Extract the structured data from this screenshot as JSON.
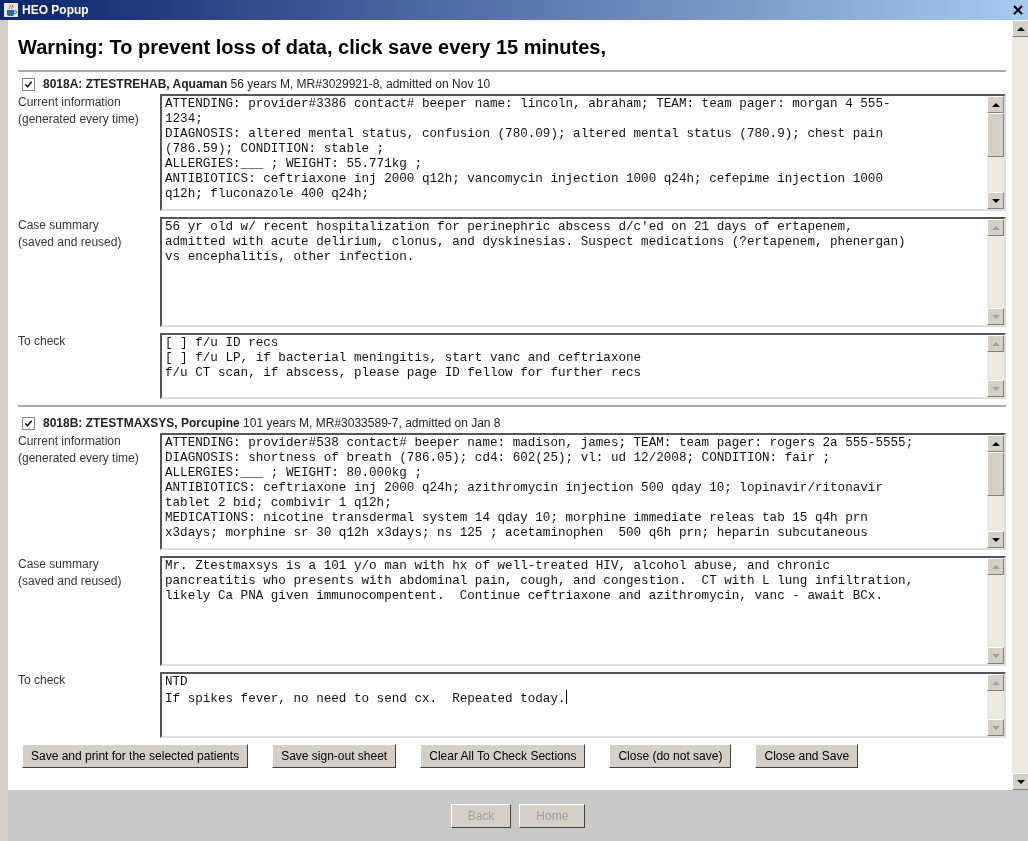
{
  "window": {
    "title": "HEO Popup"
  },
  "warning": "Warning: To prevent loss of data, click save every 15 minutes,",
  "patients": [
    {
      "checked": true,
      "header": "**8018A: ZTESTREHAB, Aquaman** 56 years M, MR#3029921-8, admitted on Nov 10",
      "fields": [
        {
          "kind": "current",
          "label": [
            "Current information",
            "(generated every time)"
          ],
          "focused": false,
          "lines": [
            "ATTENDING: provider#3386 contact# beeper name: lincoln, abraham; TEAM: team pager: morgan 4 555-",
            "1234;",
            "DIAGNOSIS: altered mental status, confusion (780.09); altered mental status (780.9); chest pain",
            "(786.59); CONDITION: stable ;",
            "ALLERGIES:___ ; WEIGHT: 55.771kg ;",
            "ANTIBIOTICS: ceftriaxone inj 2000 q12h; vancomycin injection 1000 q24h; cefepime injection 1000",
            "q12h; fluconazole 400 q24h;"
          ]
        },
        {
          "kind": "summary",
          "label": [
            "Case summary",
            "(saved and reused)"
          ],
          "focused": false,
          "lines": [
            "56 yr old w/ recent hospitalization for perinephric abscess d/c'ed on 21 days of ertapenem,",
            "admitted with acute delirium, clonus, and dyskinesias. Suspect medications (?ertapenem, phenergan)",
            "vs encephalitis, other infection."
          ]
        },
        {
          "kind": "check",
          "label": [
            "To check"
          ],
          "focused": false,
          "lines": [
            "[ ] f/u ID recs",
            "[ ] f/u LP, if bacterial meningitis, start vanc and ceftriaxone",
            "f/u CT scan, if abscess, please page ID fellow for further recs"
          ]
        }
      ]
    },
    {
      "checked": true,
      "header": "**8018B: ZTESTMAXSYS, Porcupine** 101 years M, MR#3033589-7, admitted on Jan 8",
      "fields": [
        {
          "kind": "current",
          "label": [
            "Current information",
            "(generated every time)"
          ],
          "focused": false,
          "lines": [
            "ATTENDING: provider#538 contact# beeper name: madison, james; TEAM: team pager: rogers 2a 555-5555;",
            "DIAGNOSIS: shortness of breath (786.05); cd4: 602(25); vl: ud 12/2008; CONDITION: fair ;",
            "ALLERGIES:___ ; WEIGHT: 80.000kg ;",
            "ANTIBIOTICS: ceftriaxone inj 2000 q24h; azithromycin injection 500 qday 10; lopinavir/ritonavir",
            "tablet 2 bid; combivir 1 q12h;",
            "MEDICATIONS: nicotine transdermal system 14 qday 10; morphine immediate releas tab 15 q4h prn",
            "x3days; morphine sr 30 q12h x3days; ns 125 ; acetaminophen  500 q6h prn; heparin subcutaneous"
          ]
        },
        {
          "kind": "summary",
          "label": [
            "Case summary",
            "(saved and reused)"
          ],
          "focused": false,
          "lines": [
            "Mr. Ztestmaxsys is a 101 y/o man with hx of well-treated HIV, alcohol abuse, and chronic",
            "pancreatitis who presents with abdominal pain, cough, and congestion.  CT with L lung infiltration,",
            "likely Ca PNA given immunocompentent.  Continue ceftriaxone and azithromycin, vanc - await BCx."
          ]
        },
        {
          "kind": "check",
          "label": [
            "To check"
          ],
          "focused": true,
          "lines": [
            "NTD",
            "If spikes fever, no need to send cx.  Repeated today."
          ]
        }
      ]
    }
  ],
  "buttons": [
    {
      "label": "Save and print for the selected patients",
      "disabled": false
    },
    {
      "label": "Save sign-out sheet",
      "disabled": false
    },
    {
      "label": "Clear All To Check Sections",
      "disabled": false
    },
    {
      "label": "Close (do not save)",
      "disabled": false
    },
    {
      "label": "Close and Save",
      "disabled": false
    }
  ],
  "nav_buttons": [
    {
      "label": "Back",
      "disabled": true
    },
    {
      "label": "Home",
      "disabled": true
    }
  ]
}
